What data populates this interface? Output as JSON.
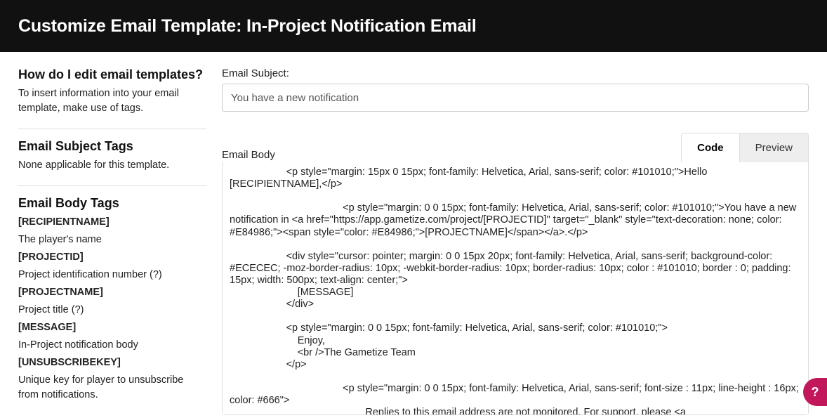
{
  "header": {
    "title": "Customize Email Template: In-Project Notification Email"
  },
  "sidebar": {
    "howto": {
      "heading": "How do I edit email templates?",
      "text": "To insert information into your email template, make use of tags."
    },
    "subjectTags": {
      "heading": "Email Subject Tags",
      "text": "None applicable for this template."
    },
    "bodyTags": {
      "heading": "Email Body Tags",
      "items": [
        {
          "tag": "[RECIPIENTNAME]",
          "desc": "The player's name"
        },
        {
          "tag": "[PROJECTID]",
          "desc": "Project identification number (?)"
        },
        {
          "tag": "[PROJECTNAME]",
          "desc": "Project title (?)"
        },
        {
          "tag": "[MESSAGE]",
          "desc": "In-Project notification body"
        },
        {
          "tag": "[UNSUBSCRIBEKEY]",
          "desc": "Unique key for player to unsubscribe from notifications."
        }
      ]
    }
  },
  "main": {
    "subjectLabel": "Email Subject:",
    "subjectValue": "You have a new notification",
    "bodyLabel": "Email Body",
    "tabs": {
      "code": "Code",
      "preview": "Preview",
      "active": "code"
    },
    "bodyValue": "                    <p style=\"margin: 15px 0 15px; font-family: Helvetica, Arial, sans-serif; color: #101010;\">Hello [RECIPIENTNAME],</p>\n\n                                        <p style=\"margin: 0 0 15px; font-family: Helvetica, Arial, sans-serif; color: #101010;\">You have a new notification in <a href=\"https://app.gametize.com/project/[PROJECTID]\" target=\"_blank\" style=\"text-decoration: none; color: #E84986;\"><span style=\"color: #E84986;\">[PROJECTNAME]</span></a>.</p>\n\n                    <div style=\"cursor: pointer; margin: 0 0 15px 20px; font-family: Helvetica, Arial, sans-serif; background-color: #ECECEC; -moz-border-radius: 10px; -webkit-border-radius: 10px; border-radius: 10px; color : #101010; border : 0; padding: 15px; width: 500px; text-align: center;\">\n                        [MESSAGE]\n                    </div>\n\n                    <p style=\"margin: 0 0 15px; font-family: Helvetica, Arial, sans-serif; color: #101010;\">\n                        Enjoy,\n                        <br />The Gametize Team\n                    </p>\n\n                                        <p style=\"margin: 0 0 15px; font-family: Helvetica, Arial, sans-serif; font-size : 11px; line-height : 16px; color: #666\">\n                                                Replies to this email address are not monitored. For support, please <a href=\"mailto:support@gametize.com\" style=\"text-decoration: none; color: #E84986;\"><span style=\"color: #E84986;\">email us"
  },
  "helpFab": {
    "label": "?"
  }
}
